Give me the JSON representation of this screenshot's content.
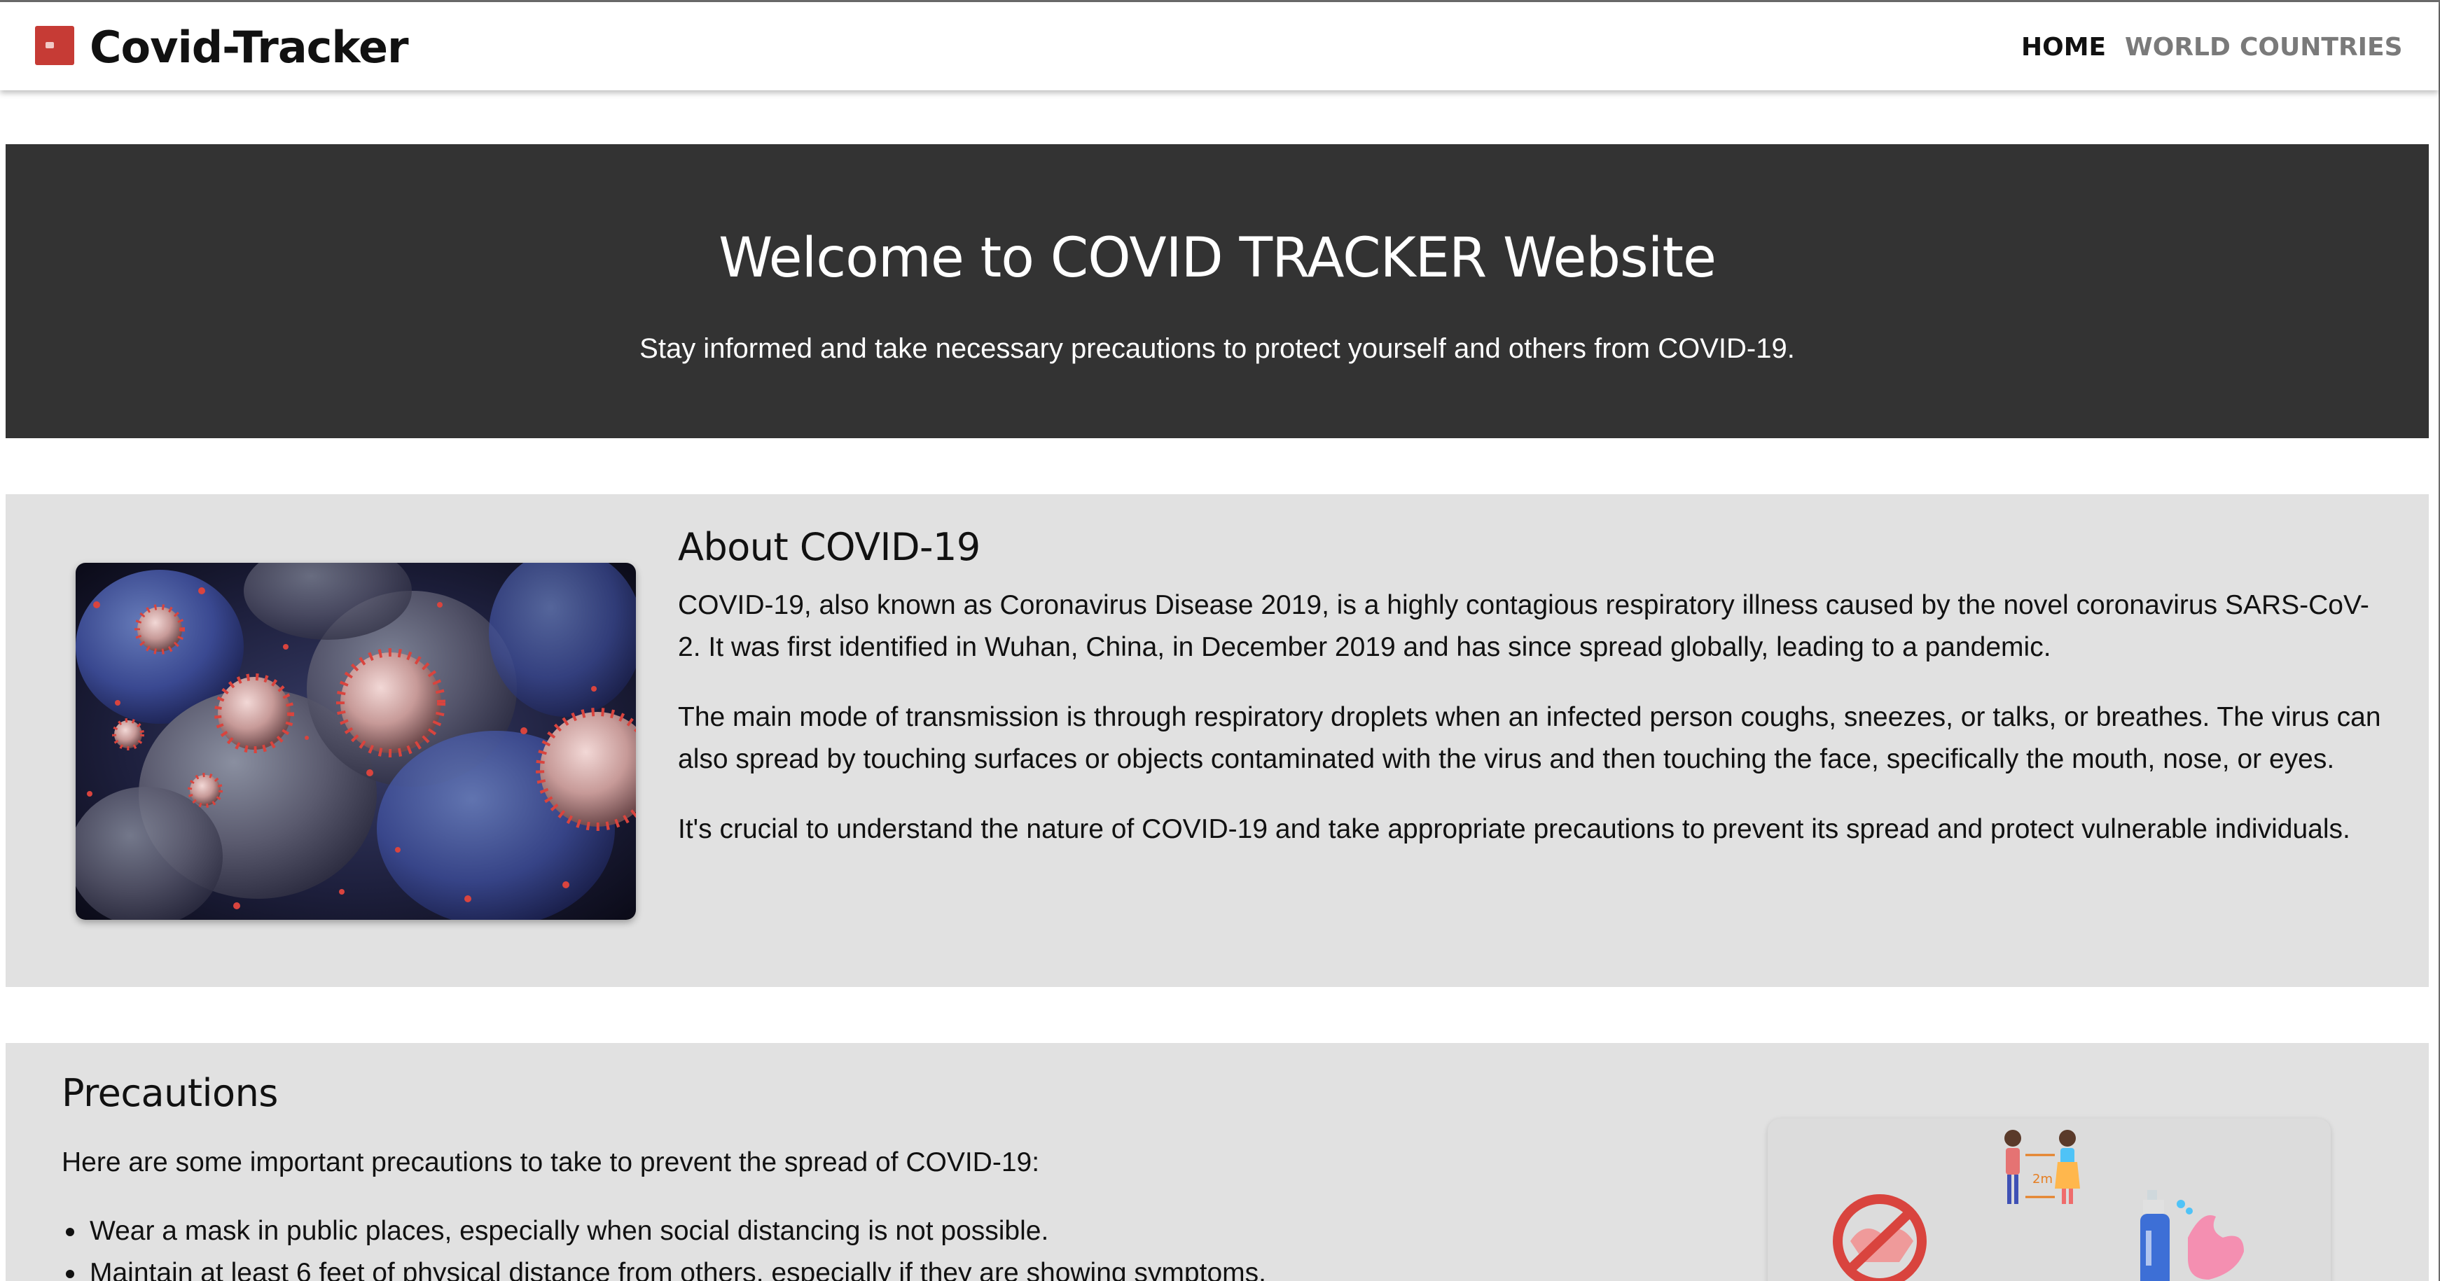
{
  "navbar": {
    "brand_title": "Covid-Tracker",
    "brand_icon": "covid-tracker-logo-icon",
    "links": [
      {
        "label": "HOME",
        "active": true
      },
      {
        "label": "WORLD",
        "active": false
      },
      {
        "label": "COUNTRIES",
        "active": false
      }
    ]
  },
  "hero": {
    "title": "Welcome to COVID TRACKER Website",
    "subtitle": "Stay informed and take necessary precautions to protect yourself and others from COVID-19."
  },
  "about": {
    "heading": "About COVID-19",
    "image": "coronavirus-microscope-image",
    "paragraphs": [
      "COVID-19, also known as Coronavirus Disease 2019, is a highly contagious respiratory illness caused by the novel coronavirus SARS-CoV-2. It was first identified in Wuhan, China, in December 2019 and has since spread globally, leading to a pandemic.",
      "The main mode of transmission is through respiratory droplets when an infected person coughs, sneezes, or talks, or breathes. The virus can also spread by touching surfaces or objects contaminated with the virus and then touching the face, specifically the mouth, nose, or eyes.",
      "It's crucial to understand the nature of COVID-19 and take appropriate precautions to prevent its spread and protect vulnerable individuals."
    ]
  },
  "precautions": {
    "heading": "Precautions",
    "lead": "Here are some important precautions to take to prevent the spread of COVID-19:",
    "items": [
      "Wear a mask in public places, especially when social distancing is not possible.",
      "Maintain at least 6 feet of physical distance from others, especially if they are showing symptoms."
    ],
    "illustration": {
      "distance_label": "2m",
      "icons": [
        "no-handshake-icon",
        "social-distance-icon",
        "hand-sanitizer-icon"
      ]
    }
  },
  "colors": {
    "hero_bg": "#333333",
    "section_bg": "#e1e1e1",
    "brand_accent": "#c63b35",
    "nav_active": "#111111",
    "nav_inactive": "#7a7a7a"
  }
}
